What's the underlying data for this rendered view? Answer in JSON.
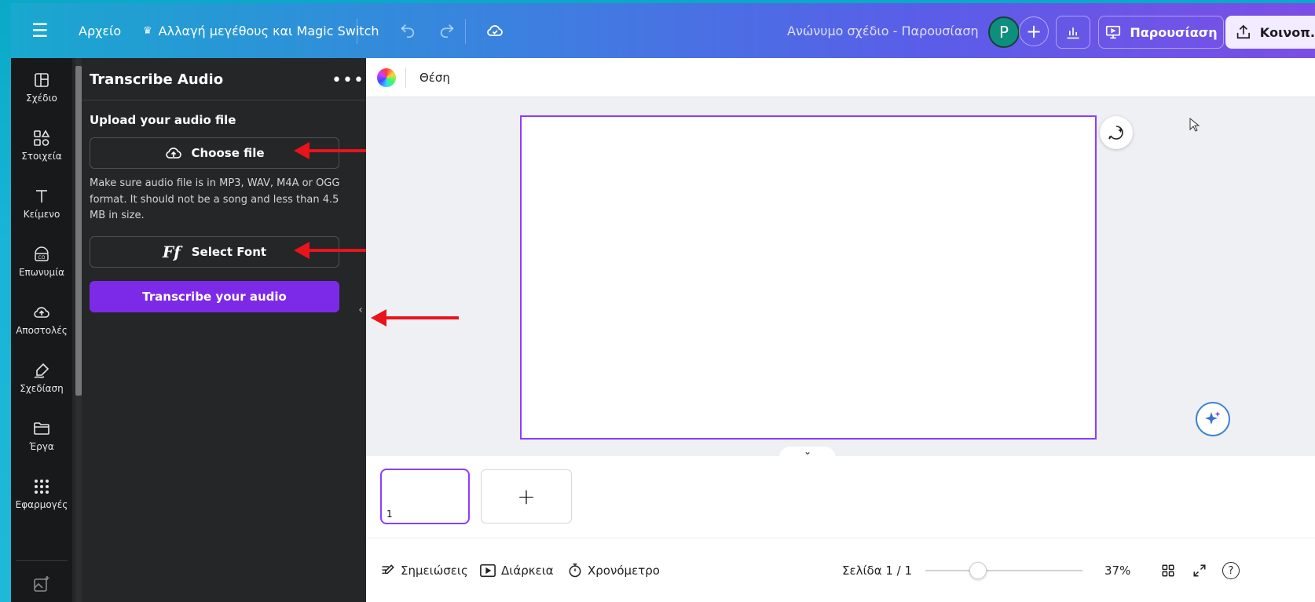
{
  "topbar": {
    "menu_icon": "hamburger-icon",
    "file_label": "Αρχείο",
    "magic_label": "Αλλαγή μεγέθους και Magic Switch",
    "crown_icon": "crown-icon",
    "undo_icon": "undo-icon",
    "redo_icon": "redo-icon",
    "save_status_icon": "cloud-check-icon",
    "doc_title": "Ανώνυμο σχέδιο - Παρουσίαση",
    "avatar_initial": "P",
    "add_icon": "plus-icon",
    "stats_icon": "bar-chart-icon",
    "present_label": "Παρουσίαση",
    "share_label": "Κοινοπ."
  },
  "rail": {
    "items": [
      {
        "label": "Σχέδιο",
        "icon": "layout-icon"
      },
      {
        "label": "Στοιχεία",
        "icon": "shapes-icon"
      },
      {
        "label": "Κείμενο",
        "icon": "text-icon"
      },
      {
        "label": "Επωνυμία",
        "icon": "brand-icon"
      },
      {
        "label": "Αποστολές",
        "icon": "upload-cloud-icon"
      },
      {
        "label": "Σχεδίαση",
        "icon": "draw-icon"
      },
      {
        "label": "Έργα",
        "icon": "folder-icon"
      },
      {
        "label": "Εφαρμογές",
        "icon": "apps-grid-icon"
      }
    ]
  },
  "panel": {
    "title": "Transcribe Audio",
    "more_icon": "more-dots-icon",
    "upload_label": "Upload your audio file",
    "choose_file_label": "Choose file",
    "hint": "Make sure audio file is in MP3, WAV, M4A or OGG format. It should not be a song and less than 4.5 MB in size.",
    "select_font_label": "Select Font",
    "select_font_glyph": "Ff",
    "transcribe_label": "Transcribe your audio"
  },
  "editor": {
    "position_label": "Θέση",
    "thumb_page_number": "1",
    "add_page_glyph": "+"
  },
  "bottombar": {
    "notes_label": "Σημειώσεις",
    "duration_label": "Διάρκεια",
    "timer_label": "Χρονόμετρο",
    "page_info": "Σελίδα 1 / 1",
    "zoom_label": "37%",
    "zoom_level": 0.37,
    "help_glyph": "?"
  },
  "colors": {
    "accent": "#8b3dff",
    "transcribe_button": "#7d2ae8",
    "annotation_arrow": "#e8141c"
  }
}
